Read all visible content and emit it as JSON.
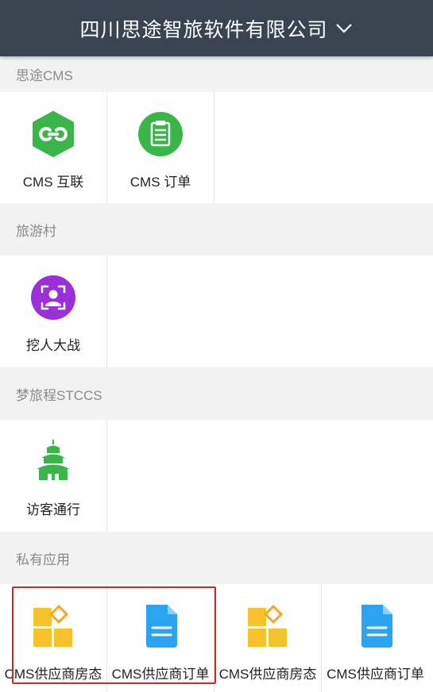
{
  "header": {
    "company_name": "四川思途智旅软件有限公司"
  },
  "sections": [
    {
      "title": "思途CMS",
      "apps": [
        {
          "label": "CMS 互联",
          "icon": "link-hexagon-icon"
        },
        {
          "label": "CMS 订单",
          "icon": "clipboard-icon"
        }
      ]
    },
    {
      "title": "旅游村",
      "apps": [
        {
          "label": "挖人大战",
          "icon": "face-scan-icon"
        }
      ]
    },
    {
      "title": "梦旅程STCCS",
      "apps": [
        {
          "label": "访客通行",
          "icon": "pagoda-icon"
        }
      ]
    },
    {
      "title": "私有应用",
      "apps": [
        {
          "label": "CMS供应商房态",
          "icon": "room-status-icon"
        },
        {
          "label": "CMS供应商订单",
          "icon": "document-icon"
        },
        {
          "label": "CMS供应商房态",
          "icon": "room-status-icon"
        },
        {
          "label": "CMS供应商订单",
          "icon": "document-icon"
        }
      ]
    }
  ],
  "colors": {
    "header_bg": "#3a4450",
    "green": "#3ab54a",
    "purple": "#9b2fd9",
    "yellow": "#f6c12b",
    "blue": "#2aa3f0",
    "highlight": "#e02020"
  }
}
